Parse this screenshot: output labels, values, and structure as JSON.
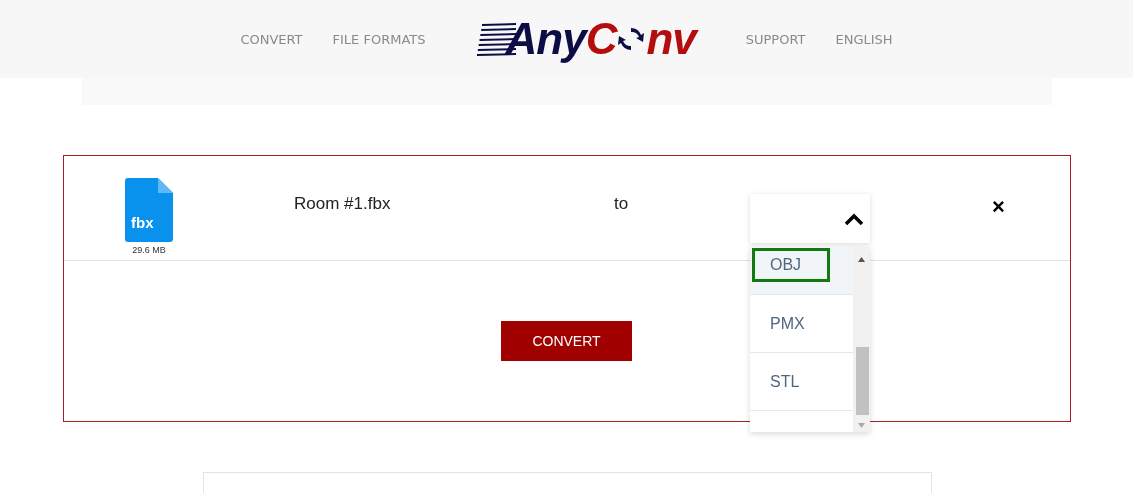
{
  "nav_left": [
    "CONVERT",
    "FILE FORMATS"
  ],
  "logo": {
    "first": "Any",
    "second": "C",
    "third": "nv"
  },
  "nav_right": [
    "SUPPORT",
    "ENGLISH"
  ],
  "file": {
    "extension": "fbx",
    "size": "29.6 MB",
    "name": "Room #1.fbx",
    "to": "to",
    "remove": "×"
  },
  "format_select": {
    "expanded": true,
    "options": [
      {
        "label": "OBJ",
        "selected": true
      },
      {
        "label": "PMX",
        "selected": false
      },
      {
        "label": "STL",
        "selected": false
      }
    ]
  },
  "convert_button": "CONVERT"
}
